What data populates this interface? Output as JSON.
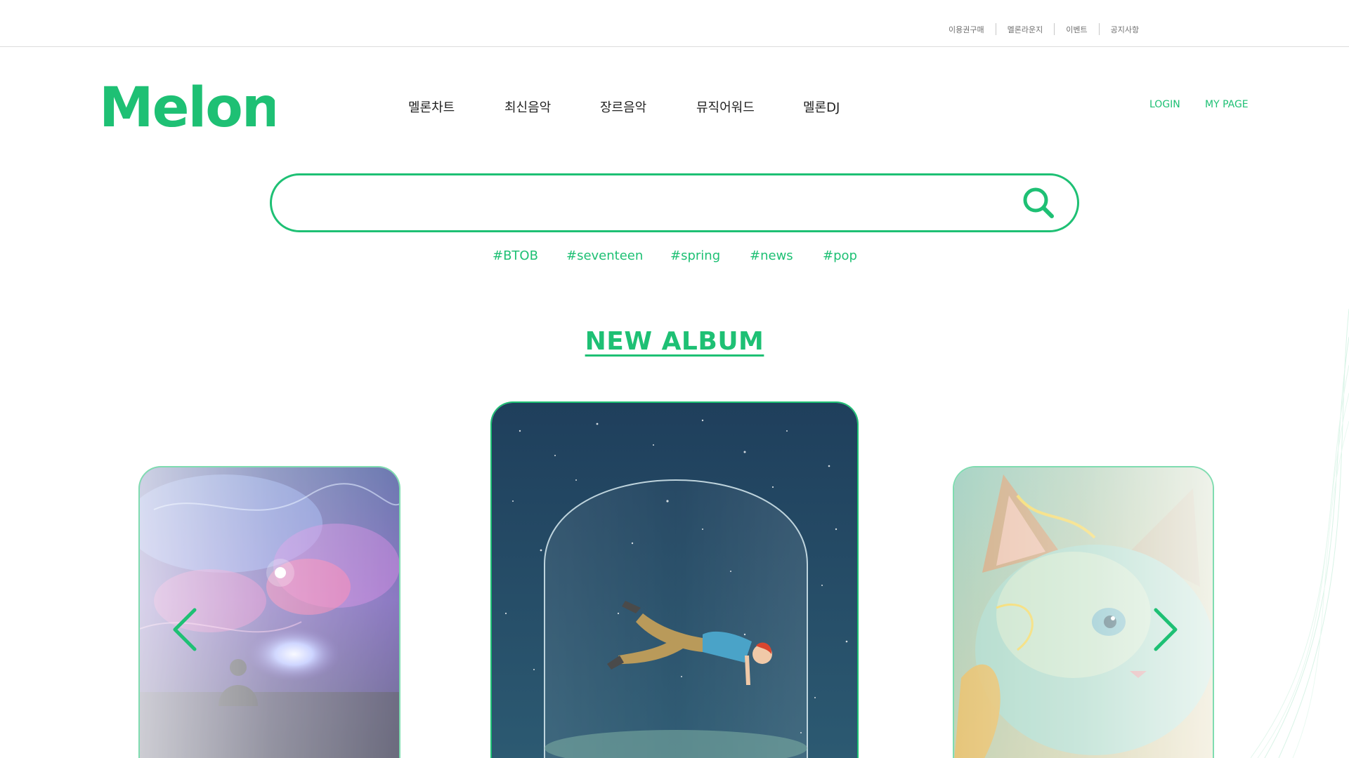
{
  "utility_nav": {
    "links": [
      "이용권구매",
      "멜론라운지",
      "이벤트",
      "공지사항"
    ]
  },
  "brand": {
    "logo_text": "Melon",
    "accent_color": "#1ec074"
  },
  "main_nav": {
    "items": [
      "멜론차트",
      "최신음악",
      "장르음악",
      "뮤직어워드",
      "멜론DJ"
    ]
  },
  "auth": {
    "login_label": "LOGIN",
    "mypage_label": "MY PAGE"
  },
  "search": {
    "value": "",
    "placeholder": "",
    "icon": "search-icon"
  },
  "hashtags": [
    "#BTOB",
    "#seventeen",
    "#spring",
    "#news",
    "#pop"
  ],
  "new_album": {
    "title": "NEW ALBUM",
    "prev_icon": "chevron-left-icon",
    "next_icon": "chevron-right-icon",
    "cards": [
      {
        "position": "left",
        "artwork": "cosmic-nebula-artwork"
      },
      {
        "position": "center",
        "artwork": "man-floating-in-glass-dome-artwork"
      },
      {
        "position": "right",
        "artwork": "fluffy-kitten-painting-artwork"
      }
    ]
  }
}
